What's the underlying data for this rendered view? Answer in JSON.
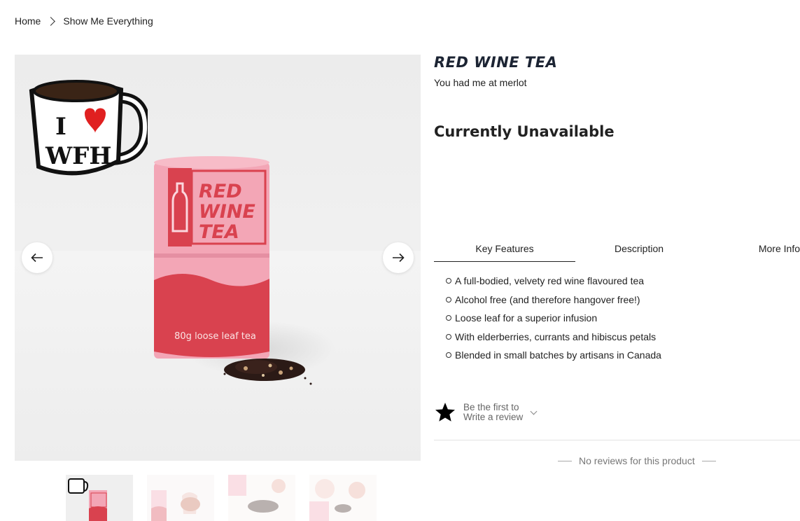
{
  "breadcrumb": {
    "home": "Home",
    "current": "Show Me Everything"
  },
  "gallery": {
    "mug_text_line1": "I",
    "mug_text_line2": "WFH",
    "package_text": [
      "RED",
      "WINE",
      "TEA"
    ],
    "package_caption": "80g loose leaf tea",
    "prev_icon": "arrow-left-icon",
    "next_icon": "arrow-right-icon",
    "thumbnail_count": 4
  },
  "product": {
    "title": "RED WINE TEA",
    "tagline": "You had me at merlot",
    "availability": "Currently Unavailable"
  },
  "tabs": [
    {
      "label": "Key Features",
      "active": true
    },
    {
      "label": "Description",
      "active": false
    },
    {
      "label": "More Info",
      "active": false
    }
  ],
  "features": [
    "A full-bodied, velvety red wine flavoured tea",
    "Alcohol free (and therefore hangover free!)",
    "Loose leaf for a superior infusion",
    "With elderberries, currants and hibiscus petals",
    "Blended in small batches by artisans in Canada"
  ],
  "reviews": {
    "prompt_line1": "Be the first to",
    "prompt_line2": "Write a review",
    "empty_message": "No reviews for this product",
    "star_icon": "star-icon"
  },
  "colors": {
    "brand_red": "#d9424f",
    "package_pink": "#f4a0b2",
    "title_navy": "#1c2433"
  }
}
